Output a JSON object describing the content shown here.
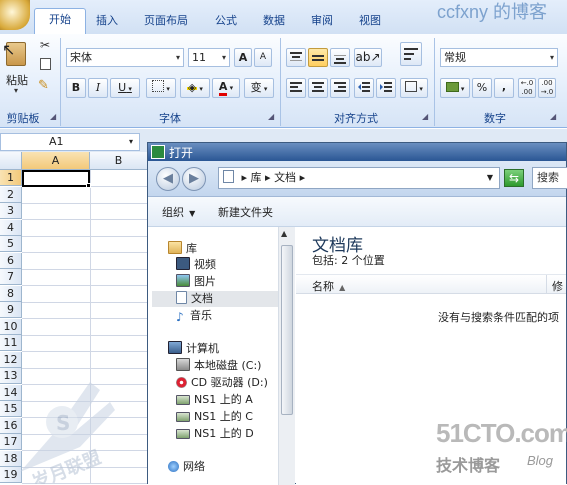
{
  "excel": {
    "tabs": [
      "开始",
      "插入",
      "页面布局",
      "公式",
      "数据",
      "审阅",
      "视图"
    ],
    "active_tab": "开始",
    "brand_watermark": "ccfxny 的博客",
    "groups": {
      "clipboard": {
        "title": "剪贴板",
        "paste_label": "粘贴"
      },
      "font": {
        "title": "字体",
        "font_name": "宋体",
        "font_size": "11",
        "grow": "A",
        "shrink": "A",
        "bold": "B",
        "italic": "I",
        "underline": "U",
        "phonetic": "变"
      },
      "alignment": {
        "title": "对齐方式"
      },
      "number": {
        "title": "数字",
        "format": "常规",
        "percent": "%",
        "comma": ","
      }
    },
    "name_box": "A1",
    "columns": [
      "A",
      "B"
    ],
    "rows": [
      "1",
      "2",
      "3",
      "4",
      "5",
      "6",
      "7",
      "8",
      "9",
      "10",
      "11",
      "12",
      "13",
      "14",
      "15",
      "16",
      "17",
      "18",
      "19"
    ]
  },
  "dialog": {
    "title": "打开",
    "address": [
      "库",
      "文档"
    ],
    "search_label": "搜索",
    "commands": {
      "organize": "组织",
      "new_folder": "新建文件夹"
    },
    "nav": {
      "libraries": {
        "label": "库",
        "items": [
          "视频",
          "图片",
          "文档",
          "音乐"
        ],
        "selected": "文档"
      },
      "computer": {
        "label": "计算机",
        "items": [
          "本地磁盘 (C:)",
          "CD 驱动器 (D:)",
          "NS1 上的 A",
          "NS1 上的 C",
          "NS1 上的 D"
        ]
      },
      "network": {
        "label": "网络"
      }
    },
    "library_title": "文档库",
    "includes": "包括: 2 个位置",
    "columns": {
      "name": "名称",
      "modified": "修"
    },
    "empty_message": "没有与搜索条件匹配的项"
  },
  "watermarks": {
    "site": "51CTO.com",
    "site_sub": "技术博客",
    "blog": "Blog",
    "logo_text": "岁月联盟"
  }
}
